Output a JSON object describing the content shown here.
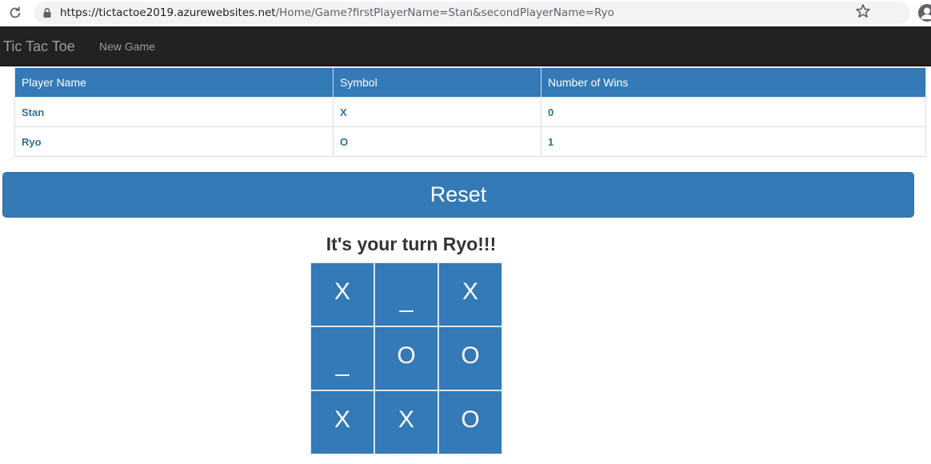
{
  "browser": {
    "url_host": "https://tictactoe2019.azurewebsites.net",
    "url_path": "/Home/Game?firstPlayerName=Stan&secondPlayerName=Ryo",
    "icons": [
      "reload-icon",
      "lock-icon",
      "star-icon",
      "profile-icon"
    ]
  },
  "navbar": {
    "brand": "Tic Tac Toe",
    "new_game": "New Game"
  },
  "players_table": {
    "headers": [
      "Player Name",
      "Symbol",
      "Number of Wins"
    ],
    "rows": [
      [
        "Stan",
        "X",
        "0"
      ],
      [
        "Ryo",
        "O",
        "1"
      ]
    ]
  },
  "reset_label": "Reset",
  "turn_message": "It's your turn Ryo!!!",
  "board": [
    [
      "X",
      "_",
      "X"
    ],
    [
      "_",
      "O",
      "O"
    ],
    [
      "X",
      "X",
      "O"
    ]
  ],
  "colors": {
    "primary": "#337ab7",
    "navbar": "#222222",
    "player_text": "#31708f"
  }
}
